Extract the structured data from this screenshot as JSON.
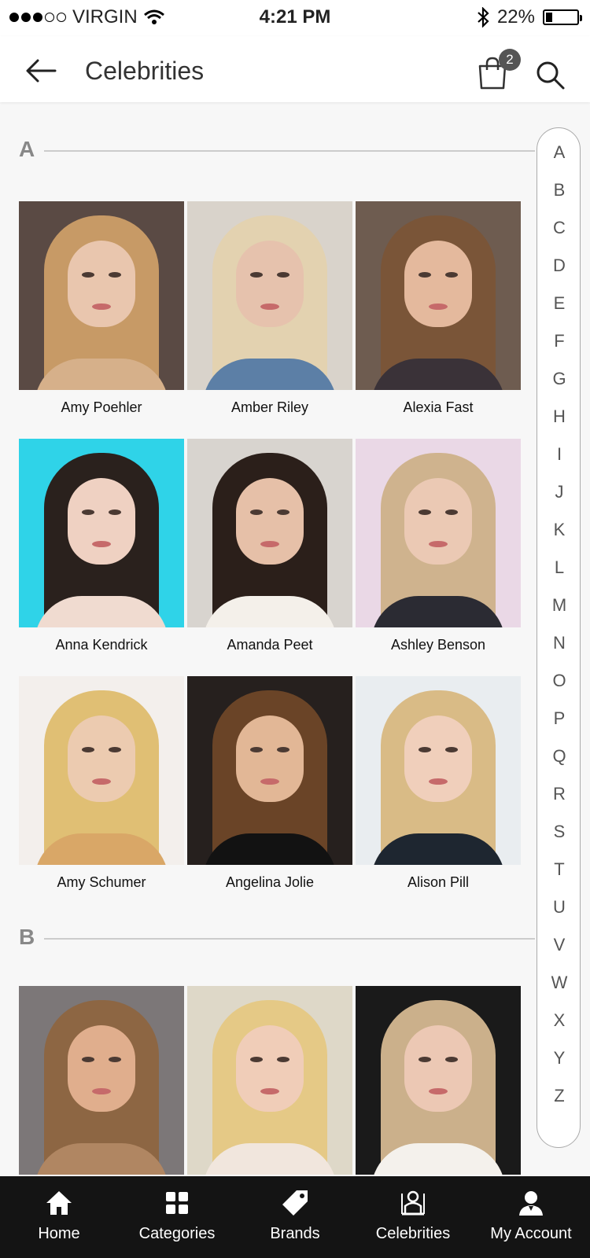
{
  "status": {
    "carrier": "VIRGIN",
    "time": "4:21 PM",
    "battery": "22%",
    "battery_level": 0.22
  },
  "header": {
    "title": "Celebrities",
    "cart_count": "2"
  },
  "sections": [
    {
      "letter": "A",
      "items": [
        {
          "name": "Amy Poehler",
          "bg": "#5a4a44",
          "hair": "#c79a66",
          "skin": "#e9c6ae",
          "top": "#d6b08a"
        },
        {
          "name": "Amber Riley",
          "bg": "#d9d3cb",
          "hair": "#e3d2b0",
          "skin": "#e6c2ad",
          "top": "#5c7fa6"
        },
        {
          "name": "Alexia Fast",
          "bg": "#6e5c50",
          "hair": "#7a5538",
          "skin": "#e4b99d",
          "top": "#3a3238"
        },
        {
          "name": "Anna Kendrick",
          "bg": "#2fd3e8",
          "hair": "#2a211d",
          "skin": "#efd1c2",
          "top": "#f0dbd0"
        },
        {
          "name": "Amanda Peet",
          "bg": "#d8d4cf",
          "hair": "#2b1f1a",
          "skin": "#e6c0a8",
          "top": "#f4f0ea"
        },
        {
          "name": "Ashley Benson",
          "bg": "#ead8e6",
          "hair": "#cfb38e",
          "skin": "#ebc9b4",
          "top": "#2b2b33"
        },
        {
          "name": "Amy Schumer",
          "bg": "#f3efec",
          "hair": "#e0bf74",
          "skin": "#eccbb0",
          "top": "#d9a767"
        },
        {
          "name": "Angelina Jolie",
          "bg": "#26201e",
          "hair": "#6a4427",
          "skin": "#e2b796",
          "top": "#121212"
        },
        {
          "name": "Alison Pill",
          "bg": "#e9edf0",
          "hair": "#d9bb86",
          "skin": "#f0cfbb",
          "top": "#1e2630"
        }
      ]
    },
    {
      "letter": "B",
      "items": [
        {
          "name": "",
          "bg": "#7c7778",
          "hair": "#8d6643",
          "skin": "#e0ae8d",
          "top": "#b08662"
        },
        {
          "name": "",
          "bg": "#ded8c8",
          "hair": "#e5c986",
          "skin": "#f0cdb8",
          "top": "#f1e6dd"
        },
        {
          "name": "",
          "bg": "#1a1a1a",
          "hair": "#cbb08b",
          "skin": "#ecc8b4",
          "top": "#f4f1ec"
        }
      ]
    }
  ],
  "alphabet": [
    "A",
    "B",
    "C",
    "D",
    "E",
    "F",
    "G",
    "H",
    "I",
    "J",
    "K",
    "L",
    "M",
    "N",
    "O",
    "P",
    "Q",
    "R",
    "S",
    "T",
    "U",
    "V",
    "W",
    "X",
    "Y",
    "Z"
  ],
  "nav": [
    {
      "label": "Home",
      "icon": "home-icon"
    },
    {
      "label": "Categories",
      "icon": "grid-icon"
    },
    {
      "label": "Brands",
      "icon": "tag-icon"
    },
    {
      "label": "Celebrities",
      "icon": "celebrity-icon"
    },
    {
      "label": "My Account",
      "icon": "account-icon"
    }
  ]
}
